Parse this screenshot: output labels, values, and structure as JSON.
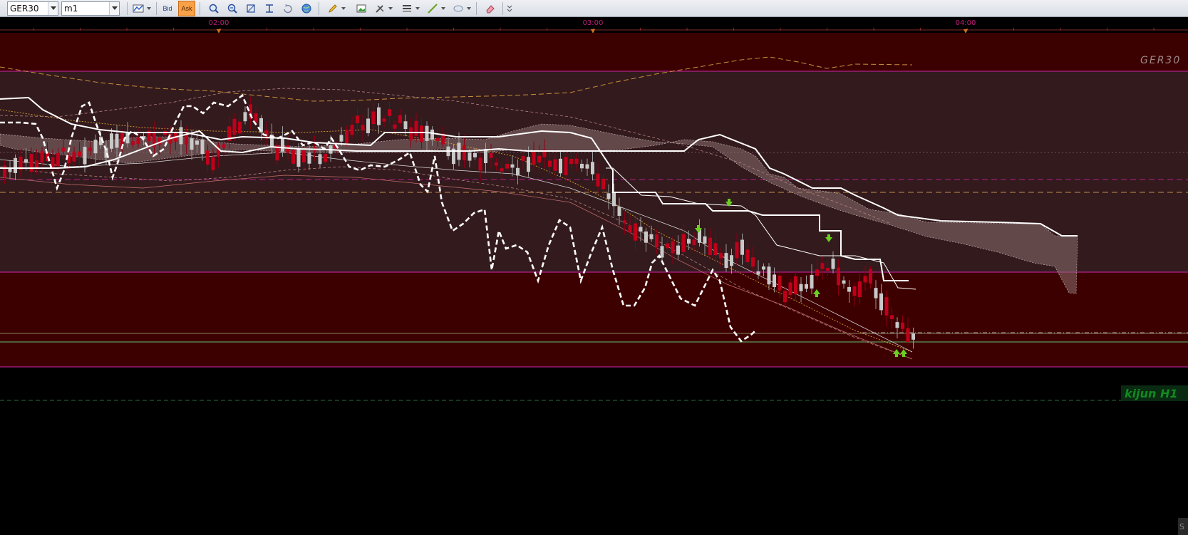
{
  "toolbar": {
    "symbol": "GER30",
    "timeframe": "m1",
    "bid_label": "Bid",
    "ask_label": "Ask"
  },
  "time_axis": {
    "labels": [
      "02:00",
      "03:00",
      "04:00"
    ]
  },
  "chart": {
    "watermark": "GER30",
    "kijun_label": "kijun H1",
    "corner_label": "S"
  },
  "colors": {
    "label_magenta": "#c0207a",
    "bg_zone": "#3d0000",
    "mid_zone": "#341a1d",
    "bull_candle": "#c8c8c8",
    "bear_candle": "#c0001a",
    "kijun_green": "#138a21"
  }
}
